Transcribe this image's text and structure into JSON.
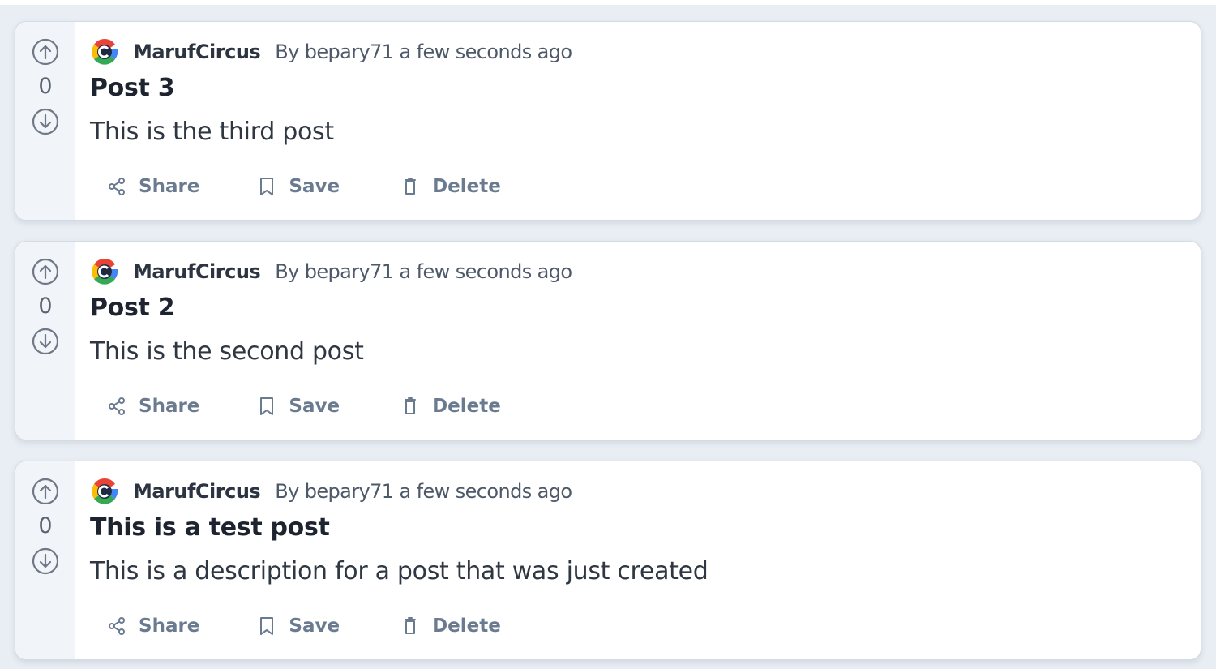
{
  "posts": [
    {
      "votes": "0",
      "community": "MarufCircus",
      "meta": "By bepary71 a few seconds ago",
      "title": "Post 3",
      "description": "This is the third post",
      "actions": {
        "share": "Share",
        "save": "Save",
        "delete": "Delete"
      }
    },
    {
      "votes": "0",
      "community": "MarufCircus",
      "meta": "By bepary71 a few seconds ago",
      "title": "Post 2",
      "description": "This is the second post",
      "actions": {
        "share": "Share",
        "save": "Save",
        "delete": "Delete"
      }
    },
    {
      "votes": "0",
      "community": "MarufCircus",
      "meta": "By bepary71 a few seconds ago",
      "title": "This is a test post",
      "description": "This is a description for a post that was just created",
      "actions": {
        "share": "Share",
        "save": "Save",
        "delete": "Delete"
      }
    }
  ],
  "icons": {
    "upvote": "arrow-up-circle-icon",
    "downvote": "arrow-down-circle-icon",
    "share": "share-icon",
    "save": "bookmark-icon",
    "delete": "trash-icon",
    "community": "google-logo-icon"
  },
  "colors": {
    "action_text": "#6a7b90",
    "vote_column_bg": "#f1f4f8",
    "page_bg": "#e9eef4"
  }
}
